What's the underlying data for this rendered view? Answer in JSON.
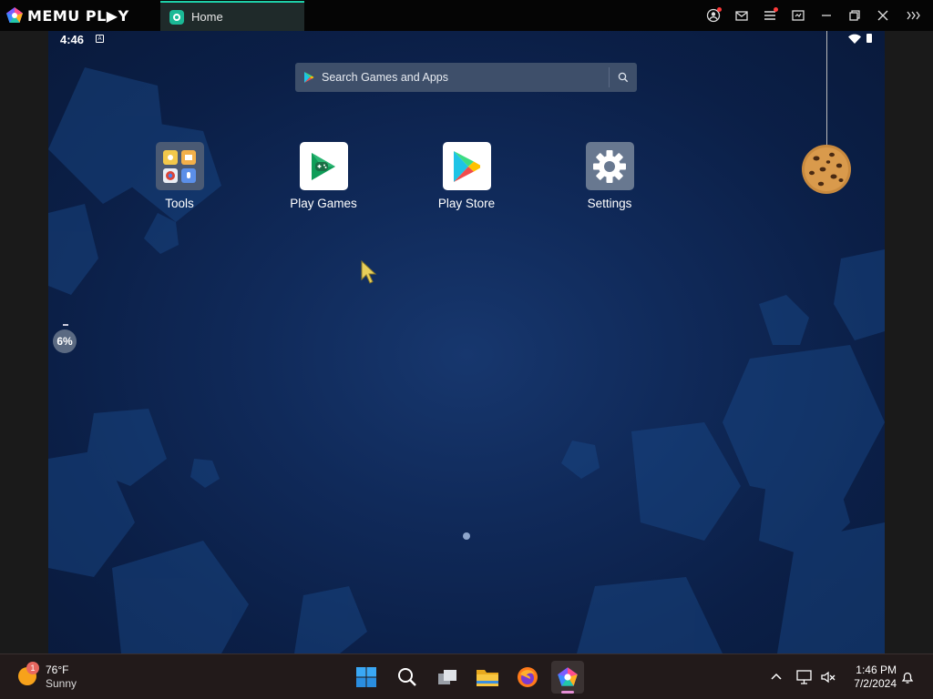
{
  "titlebar": {
    "brand": "MEMU PL▶Y",
    "tab_label": "Home",
    "buttons": [
      "account-icon",
      "mail-icon",
      "menu-icon",
      "screenshot-icon",
      "minimize-icon",
      "restore-icon",
      "close-icon",
      "expand-icon"
    ]
  },
  "android": {
    "status_time": "4:46",
    "search_placeholder": "Search Games and Apps",
    "apps": [
      {
        "label": "Tools",
        "icon": "tools-folder-icon"
      },
      {
        "label": "Play Games",
        "icon": "play-games-icon"
      },
      {
        "label": "Play Store",
        "icon": "play-store-icon"
      },
      {
        "label": "Settings",
        "icon": "settings-gear-icon"
      }
    ],
    "cpu_badge": "6%",
    "page_count": 1
  },
  "taskbar": {
    "weather_temp": "76°F",
    "weather_condition": "Sunny",
    "weather_badge": "1",
    "apps": [
      "windows-start-icon",
      "search-icon",
      "task-view-icon",
      "file-explorer-icon",
      "firefox-icon",
      "memu-icon"
    ],
    "clock_time": "1:46 PM",
    "clock_date": "7/2/2024"
  },
  "colors": {
    "accent": "#1ecfa8",
    "wallpaper": "#0b1f47",
    "taskbar": "#221a1a"
  }
}
